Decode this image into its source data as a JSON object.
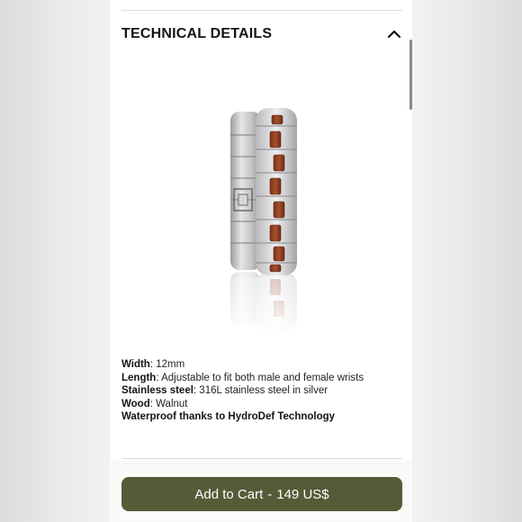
{
  "section": {
    "title": "TECHNICAL DETAILS",
    "toggle_icon": "chevron-up-icon"
  },
  "product_image": {
    "alt": "Silver stainless steel and walnut link bracelet"
  },
  "specs": {
    "width_key": "Width",
    "width_value": ": 12mm",
    "length_key": "Length",
    "length_value": ": Adjustable to fit both male and female wrists",
    "steel_key": "Stainless steel",
    "steel_value": ": 316L stainless steel in silver",
    "wood_key": "Wood",
    "wood_value": ": Walnut",
    "waterproof": "Waterproof thanks to HydroDef Technology"
  },
  "cart": {
    "label": "Add to Cart",
    "separator": "-",
    "price": "149 US$"
  },
  "colors": {
    "button": "#555b37",
    "walnut": "#8b3e22",
    "steel": "#c9c9cb"
  }
}
